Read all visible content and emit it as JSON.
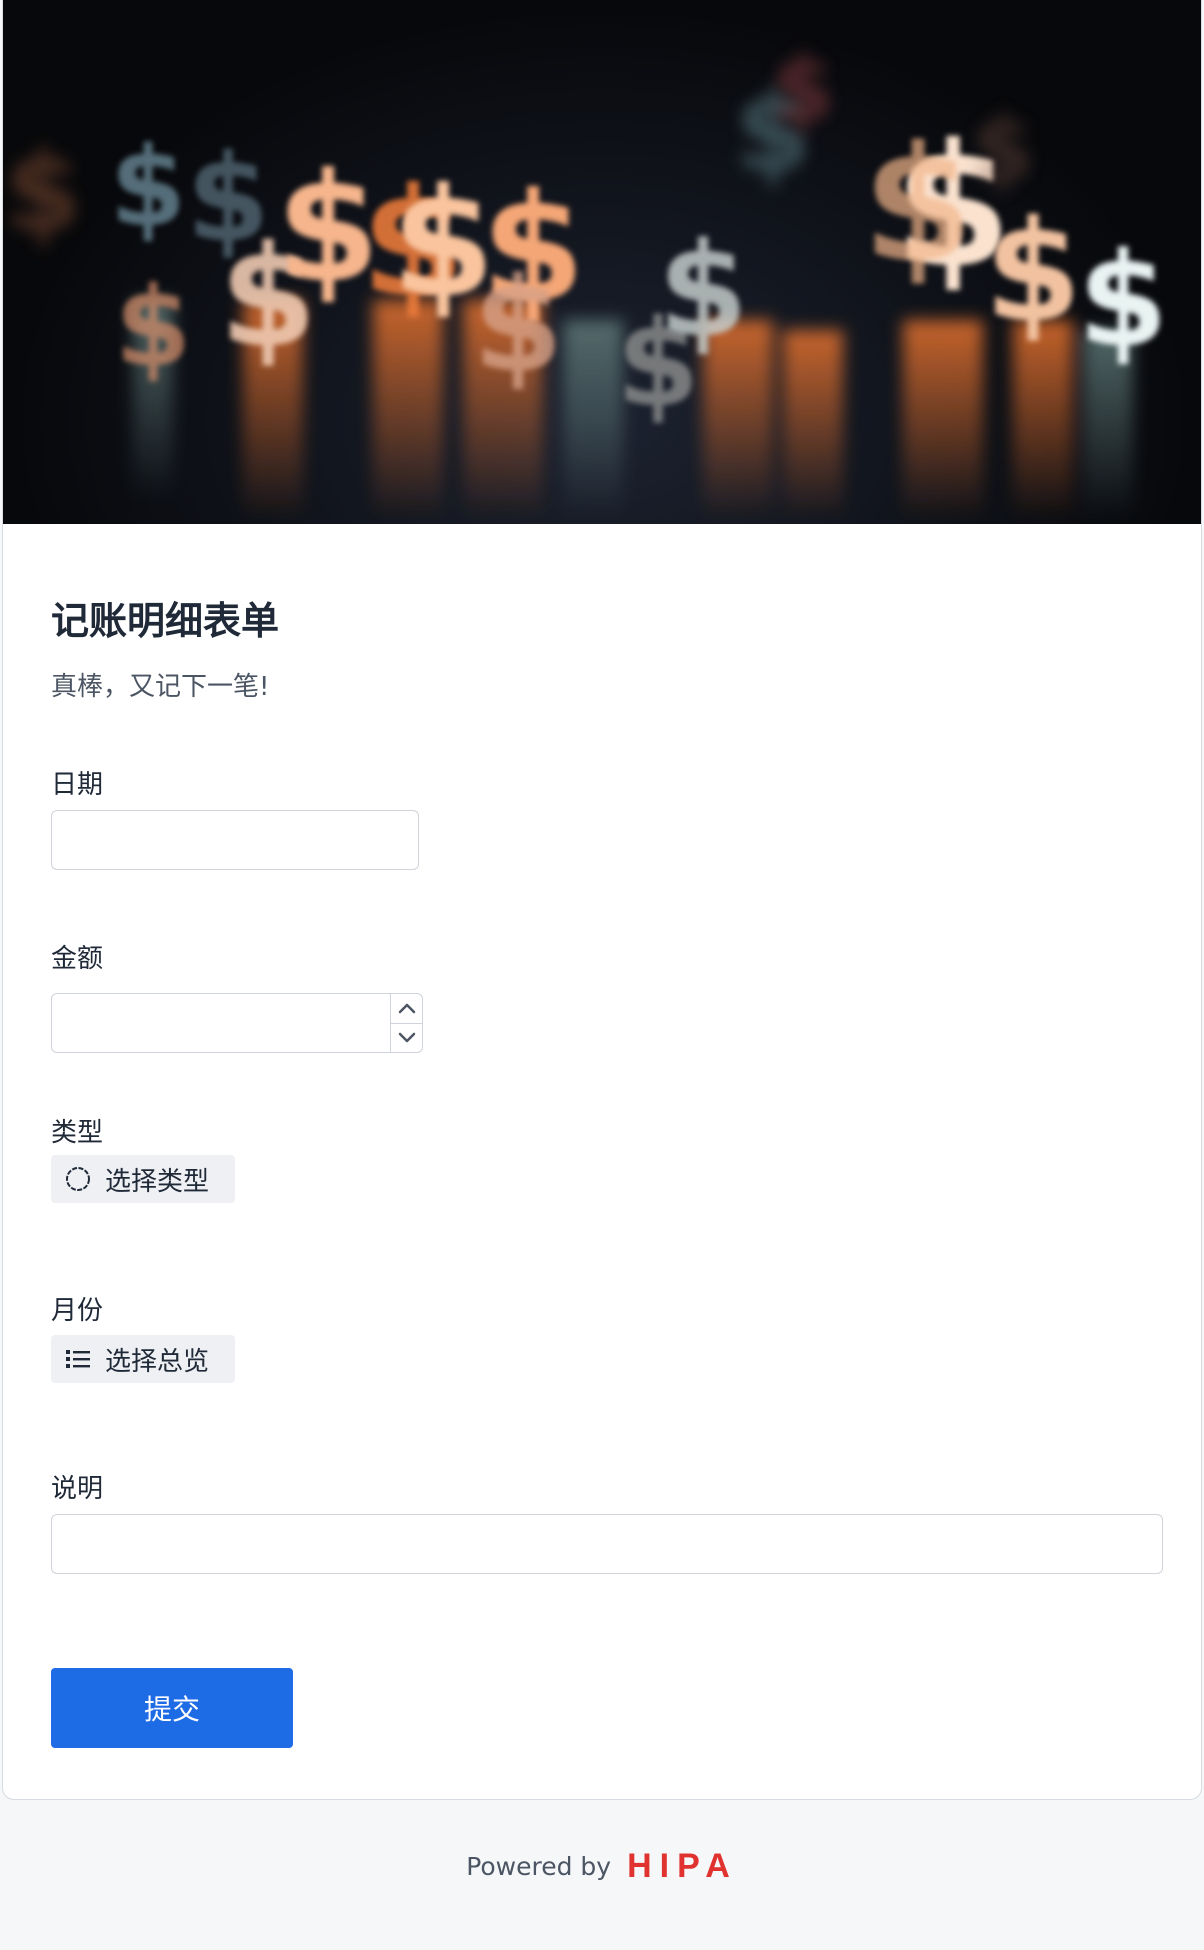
{
  "form": {
    "title": "记账明细表单",
    "subtitle": "真棒，又记下一笔!"
  },
  "fields": {
    "date": {
      "label": "日期",
      "value": ""
    },
    "amount": {
      "label": "金额",
      "value": ""
    },
    "type": {
      "label": "类型",
      "button_label": "选择类型",
      "icon": "circle-select-icon"
    },
    "month": {
      "label": "月份",
      "button_label": "选择总览",
      "icon": "list-icon"
    },
    "note": {
      "label": "说明",
      "value": ""
    }
  },
  "submit_label": "提交",
  "footer": {
    "powered_by": "Powered by",
    "brand": "HIPA"
  },
  "colors": {
    "accent": "#1e6be6",
    "brand": "#e0332f",
    "chip_bg": "#eef0f3"
  }
}
